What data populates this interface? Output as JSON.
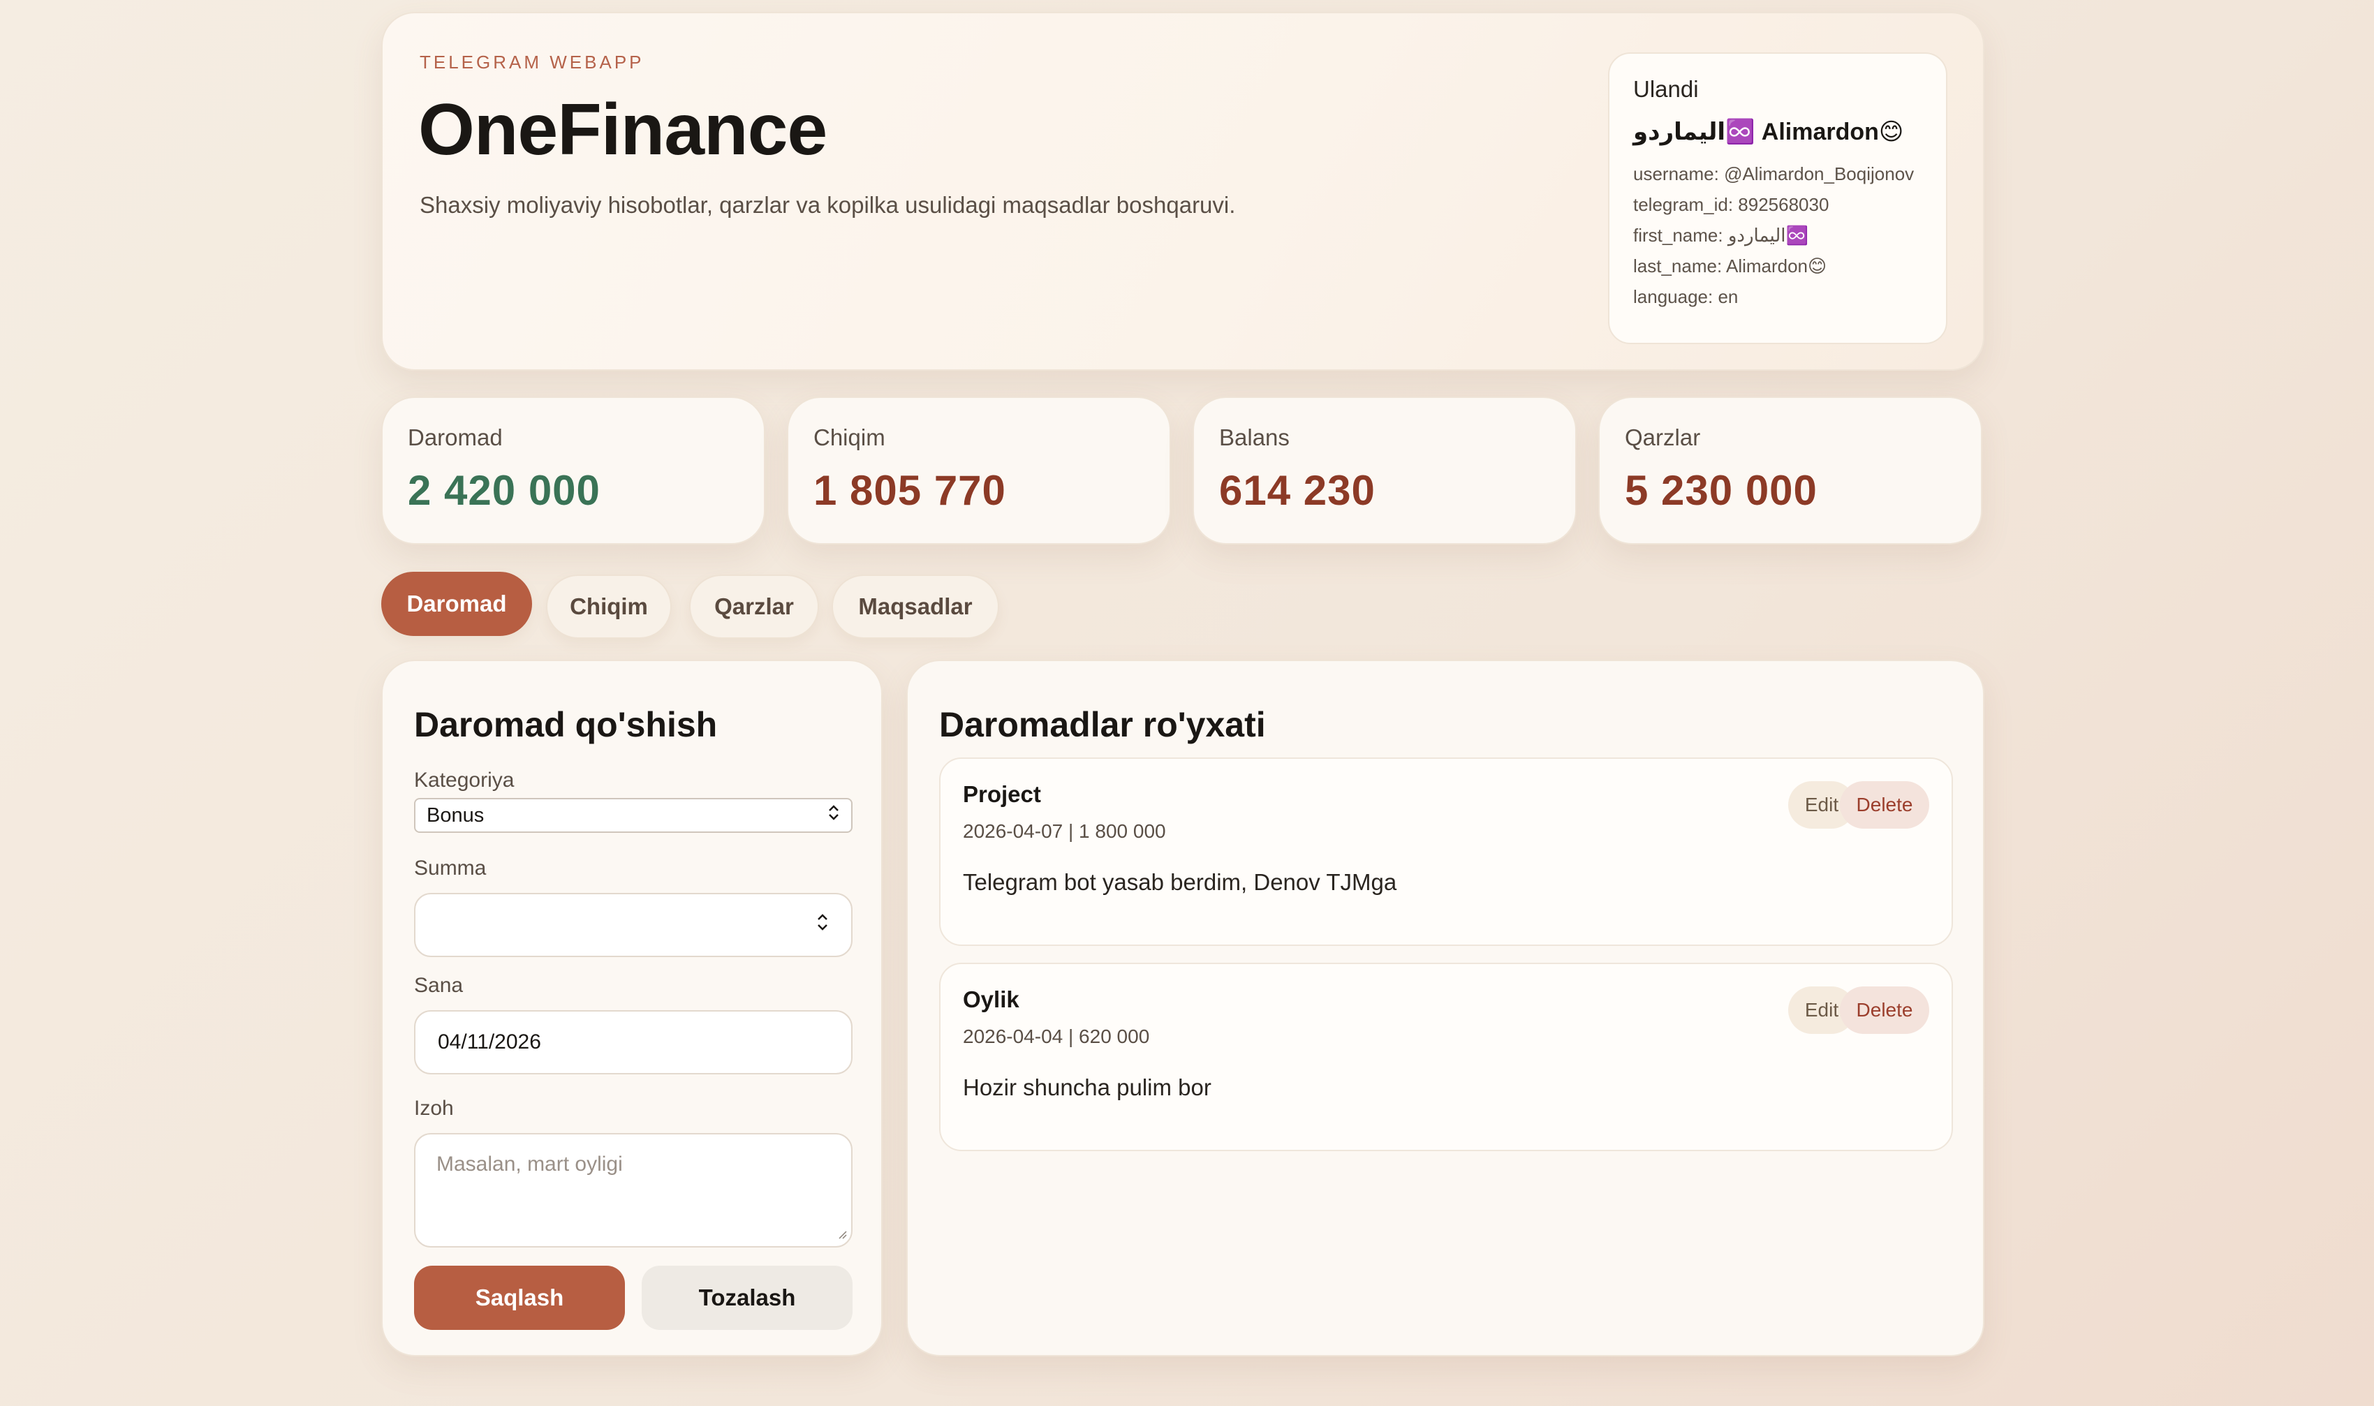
{
  "header": {
    "eyebrow": "TELEGRAM WEBAPP",
    "title": "OneFinance",
    "subtitle": "Shaxsiy moliyaviy hisobotlar, qarzlar va kopilka usulidagi maqsadlar boshqaruvi."
  },
  "user": {
    "status": "Ulandi",
    "display_name": "اليماردو♾️ Alimardon😊",
    "username": "username: @Alimardon_Boqijonov",
    "telegram_id": "telegram_id: 892568030",
    "first_name": "first_name: اليماردو♾️",
    "last_name": "last_name: Alimardon😊",
    "language": "language: en"
  },
  "stats": [
    {
      "label": "Daromad",
      "value": "2 420 000"
    },
    {
      "label": "Chiqim",
      "value": "1 805 770"
    },
    {
      "label": "Balans",
      "value": "614 230"
    },
    {
      "label": "Qarzlar",
      "value": "5 230 000"
    }
  ],
  "tabs": [
    {
      "label": "Daromad",
      "active": true
    },
    {
      "label": "Chiqim",
      "active": false
    },
    {
      "label": "Qarzlar",
      "active": false
    },
    {
      "label": "Maqsadlar",
      "active": false
    }
  ],
  "form": {
    "title": "Daromad qo'shish",
    "category_label": "Kategoriya",
    "category_value": "Bonus",
    "amount_label": "Summa",
    "amount_value": "",
    "date_label": "Sana",
    "date_value": "04/11/2026",
    "note_label": "Izoh",
    "note_placeholder": "Masalan, mart oyligi",
    "save_label": "Saqlash",
    "clear_label": "Tozalash"
  },
  "list": {
    "title": "Daromadlar ro'yxati",
    "edit_label": "Edit",
    "delete_label": "Delete",
    "items": [
      {
        "title": "Project",
        "meta": "2026-04-07 | 1 800 000",
        "note": "Telegram bot yasab berdim, Denov TJMga"
      },
      {
        "title": "Oylik",
        "meta": "2026-04-04 | 620 000",
        "note": "Hozir shuncha pulim bor"
      }
    ]
  },
  "icons": {
    "select_arrows": "updown-chevron-icon",
    "stepper": "stepper-icon",
    "resize": "resize-grip-icon"
  },
  "colors": {
    "accent": "#b75e42",
    "income": "#3a7356",
    "expense": "#8c3a26"
  }
}
